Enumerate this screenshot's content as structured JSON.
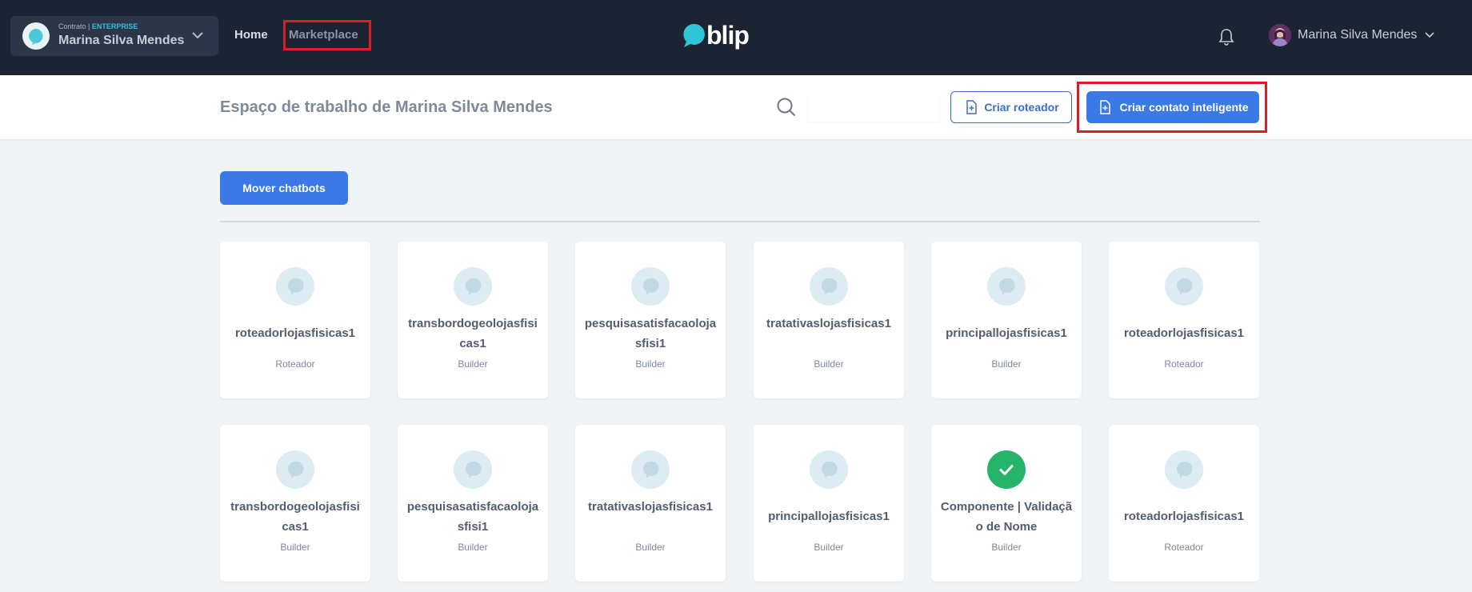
{
  "header": {
    "contract_label": "Contrato |",
    "contract_plan": "ENTERPRISE",
    "contract_name": "Marina Silva Mendes",
    "nav": {
      "home": "Home",
      "marketplace": "Marketplace"
    },
    "logo_text": "blip",
    "user_name": "Marina Silva Mendes"
  },
  "subheader": {
    "title": "Espaço de trabalho de Marina Silva Mendes",
    "search_placeholder": "",
    "create_router_label": "Criar roteador",
    "create_smart_contact_label": "Criar contato inteligente"
  },
  "main": {
    "move_button_label": "Mover chatbots",
    "bots": [
      {
        "name": "roteadorlojasfisicas1",
        "type": "Roteador",
        "icon": "chat-bubble-icon"
      },
      {
        "name": "transbordogeolojasfisicas1",
        "type": "Builder",
        "icon": "chat-bubble-icon"
      },
      {
        "name": "pesquisasatisfacaolojasfisi1",
        "type": "Builder",
        "icon": "chat-bubble-icon"
      },
      {
        "name": "tratativaslojasfisicas1",
        "type": "Builder",
        "icon": "chat-bubble-icon"
      },
      {
        "name": "principallojasfisicas1",
        "type": "Builder",
        "icon": "chat-bubble-icon"
      },
      {
        "name": "roteadorlojasfisicas1",
        "type": "Roteador",
        "icon": "chat-bubble-icon"
      },
      {
        "name": "transbordogeolojasfisicas1",
        "type": "Builder",
        "icon": "chat-bubble-icon"
      },
      {
        "name": "pesquisasatisfacaolojasfisi1",
        "type": "Builder",
        "icon": "chat-bubble-icon"
      },
      {
        "name": "tratativaslojasfisicas1",
        "type": "Builder",
        "icon": "chat-bubble-icon"
      },
      {
        "name": "principallojasfisicas1",
        "type": "Builder",
        "icon": "chat-bubble-icon"
      },
      {
        "name": "Componente | Validação de Nome",
        "type": "Builder",
        "icon": "check-icon"
      },
      {
        "name": "roteadorlojasfisicas1",
        "type": "Roteador",
        "icon": "chat-bubble-icon"
      }
    ]
  },
  "colors": {
    "topbar": "#1c2434",
    "accent": "#3b7ae6",
    "highlight": "#d81f27",
    "success": "#26b36a"
  }
}
